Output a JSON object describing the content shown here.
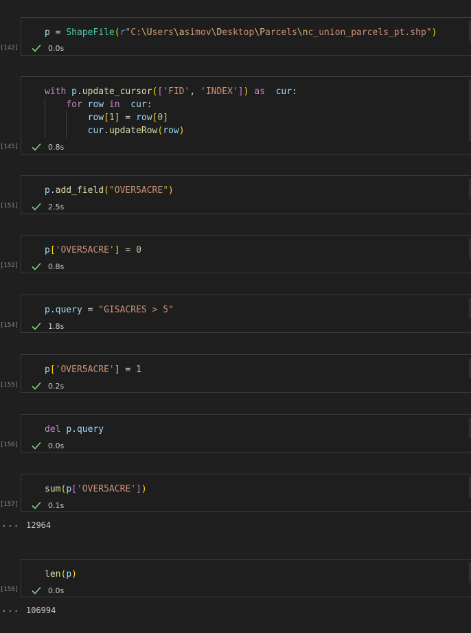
{
  "cells": [
    {
      "exec_count": "[142]",
      "time": "0.0s"
    },
    {
      "exec_count": "[145]",
      "time": "0.8s"
    },
    {
      "exec_count": "[151]",
      "time": "2.5s"
    },
    {
      "exec_count": "[152]",
      "time": "0.8s"
    },
    {
      "exec_count": "[154]",
      "time": "1.8s"
    },
    {
      "exec_count": "[155]",
      "time": "0.2s"
    },
    {
      "exec_count": "[156]",
      "time": "0.0s"
    },
    {
      "exec_count": "[157]",
      "time": "0.1s",
      "output": "12964"
    },
    {
      "exec_count": "[158]",
      "time": "0.0s",
      "output": "106994"
    }
  ],
  "tokens": {
    "p": "p",
    "cur": "cur",
    "row": "row",
    "query": "query",
    "eq": " = ",
    "dot": ".",
    "comma": ", ",
    "gt": " > ",
    "ShapeFile": "ShapeFile",
    "r": "r",
    "path_1": "\"C:",
    "path_2": "\\U",
    "path_3": "sers",
    "path_4": "\\a",
    "path_5": "simov",
    "path_6": "\\D",
    "path_7": "esktop",
    "path_8": "\\P",
    "path_9": "arcels",
    "path_10": "\\n",
    "path_11": "c_union_parcels_pt.shp\"",
    "with": "with",
    "as": " as ",
    "for": "for",
    "in": " in ",
    "del": "del ",
    "update_cursor": "update_cursor",
    "add_field": "add_field",
    "updateRow": "updateRow",
    "sum": "sum",
    "len": "len",
    "FID": "'FID'",
    "INDEX": "'INDEX'",
    "OVER5ACRE_dq": "\"OVER5ACRE\"",
    "OVER5ACRE_sq": "'OVER5ACRE'",
    "GISACRES_expr": "\"GISACRES > 5\"",
    "zero": "0",
    "one": "1",
    "lp": "(",
    "rp": ")",
    "lb": "[",
    "rb": "]",
    "colon": ":"
  },
  "output_prompt": "...",
  "colors": {
    "background": "#1f1f1f",
    "success_check": "#89d185",
    "cell_border": "#3c3c3c"
  },
  "icons": {
    "status": "check-icon"
  }
}
